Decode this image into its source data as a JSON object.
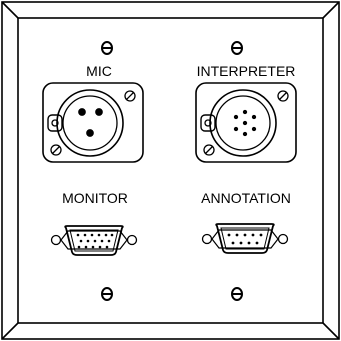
{
  "plate": {
    "face_color": "#ffffff",
    "line_color": "#000000"
  },
  "ports": [
    {
      "label": "MIC",
      "connector": "xlr-3-pin-female-icon"
    },
    {
      "label": "INTERPRETER",
      "connector": "din-7-pin-female-icon"
    },
    {
      "label": "MONITOR",
      "connector": "hd15-vga-female-icon"
    },
    {
      "label": "ANNOTATION",
      "connector": "db9-serial-female-icon"
    }
  ]
}
